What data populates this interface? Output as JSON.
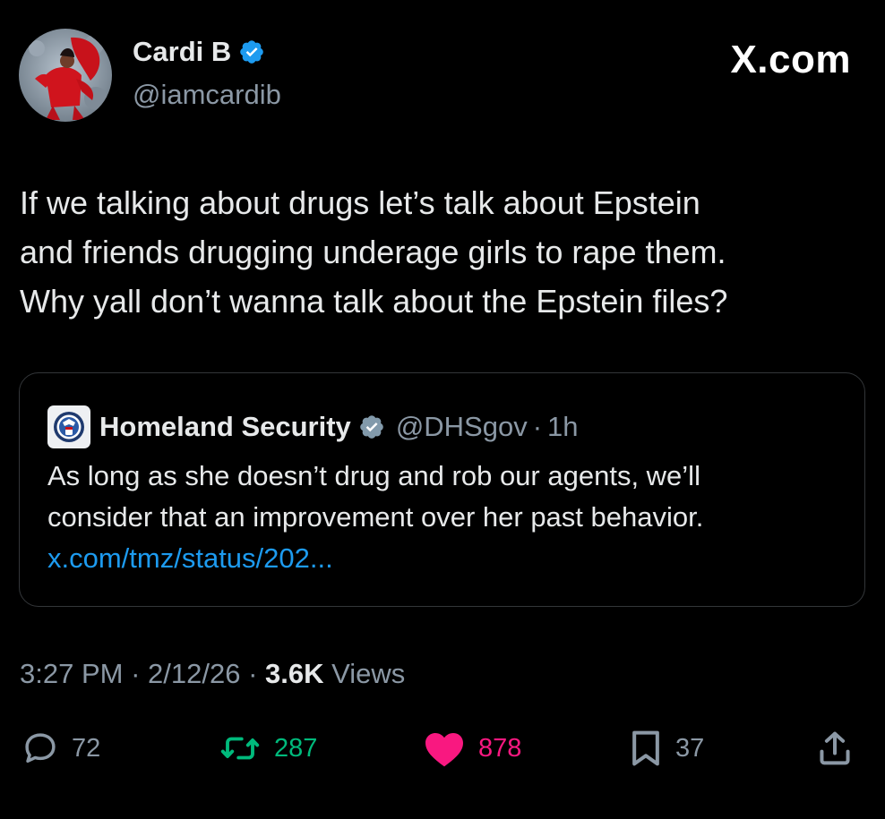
{
  "author": {
    "name": "Cardi B",
    "handle": "@iamcardib",
    "avatar_icon": "profile-photo-red-outfit"
  },
  "brand": "X.com",
  "tweet": {
    "lines": [
      "If we talking about drugs let’s talk about Epstein",
      "and friends drugging underage girls to rape them.",
      "Why yall don’t wanna talk about the Epstein files?"
    ]
  },
  "quote": {
    "name": "Homeland Security",
    "handle": "@DHSgov",
    "separator": "·",
    "time": "1h",
    "lines": [
      "As long as she doesn’t drug and rob our agents, we’ll",
      "consider that an improvement over her past behavior."
    ],
    "link": "x.com/tmz/status/202..."
  },
  "meta": {
    "time": "3:27 PM",
    "separator": "·",
    "date": "2/12/26",
    "views_count": "3.6K",
    "views_label": "Views"
  },
  "actions": {
    "replies": "72",
    "reposts": "287",
    "likes": "878",
    "bookmarks": "37"
  },
  "colors": {
    "background": "#000000",
    "text": "#e7e9ea",
    "secondary": "#8b98a5",
    "link": "#1d9bf0",
    "verified": "#1d9bf0",
    "repost": "#00ba7c",
    "like": "#f91880"
  }
}
